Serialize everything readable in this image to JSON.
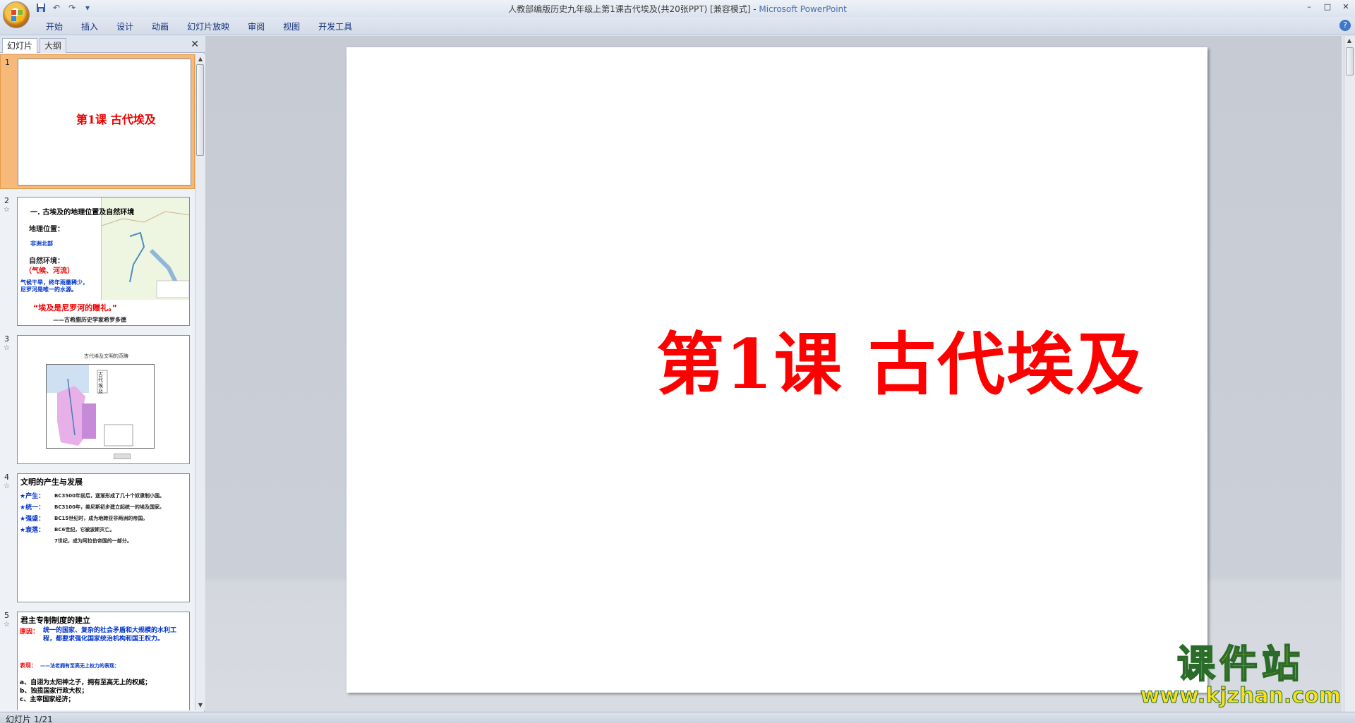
{
  "window": {
    "title": "人教部编版历史九年级上第1课古代埃及(共20张PPT) [兼容模式]",
    "separator": " - ",
    "app_name": "Microsoft PowerPoint",
    "controls": [
      "–",
      "□",
      "✕"
    ]
  },
  "qat": {
    "save": "save-icon",
    "undo": "↶",
    "redo": "↷",
    "more": "▾"
  },
  "ribbon": {
    "tabs": [
      "开始",
      "插入",
      "设计",
      "动画",
      "幻灯片放映",
      "审阅",
      "视图",
      "开发工具"
    ],
    "help": "?"
  },
  "panel": {
    "tabs": [
      "幻灯片",
      "大纲"
    ],
    "close": "✕"
  },
  "thumbnails": [
    {
      "number": "1",
      "title": "第1课 古代埃及"
    },
    {
      "number": "2",
      "title": "一. 古埃及的地理位置及自然环境",
      "lines": [
        "地理位置：",
        "非洲北部",
        "自然环境：",
        "（气候、河流）",
        "气候干旱，终年雨量稀少，",
        "尼罗河是唯一的水源。"
      ],
      "quote": "“埃及是尼罗河的赠礼。”",
      "attribution": "——古希腊历史学家希罗多德"
    },
    {
      "number": "3",
      "title": "古代埃及文明的范畴",
      "map_label": "古代埃及"
    },
    {
      "number": "4",
      "title": "文明的产生与发展",
      "items": [
        {
          "label": "★产生：",
          "text": "BC3500年前后，逐渐形成了几十个奴隶制小国。"
        },
        {
          "label": "★统一：",
          "text": "BC3100年，美尼斯初步建立起统一的埃及国家。"
        },
        {
          "label": "★强盛：",
          "text": "BC15世纪时，成为地跨亚非两洲的帝国。"
        },
        {
          "label": "★衰落：",
          "text": "BC6世纪，它被波斯灭亡。"
        },
        {
          "label": "",
          "text": "7世纪，成为阿拉伯帝国的一部分。"
        }
      ]
    },
    {
      "number": "5",
      "title": "君主专制制度的建立",
      "cause_label": "原因：",
      "cause_text": "统一的国家、复杂的社会矛盾和大规模的水利工程，都要求强化国家统治机构和国王权力。",
      "show_label": "表现：",
      "show_text": "——法老拥有至高无上权力的表现：",
      "points": [
        "a、自诩为太阳神之子，拥有至高无上的权威；",
        "b、独揽国家行政大权；",
        "c、主宰国家经济；"
      ]
    }
  ],
  "slide": {
    "title": "第1课 古代埃及"
  },
  "watermark": {
    "line1": "课件站",
    "line2": "www.kjzhan.com"
  },
  "status": {
    "text": "幻灯片 1/21"
  }
}
